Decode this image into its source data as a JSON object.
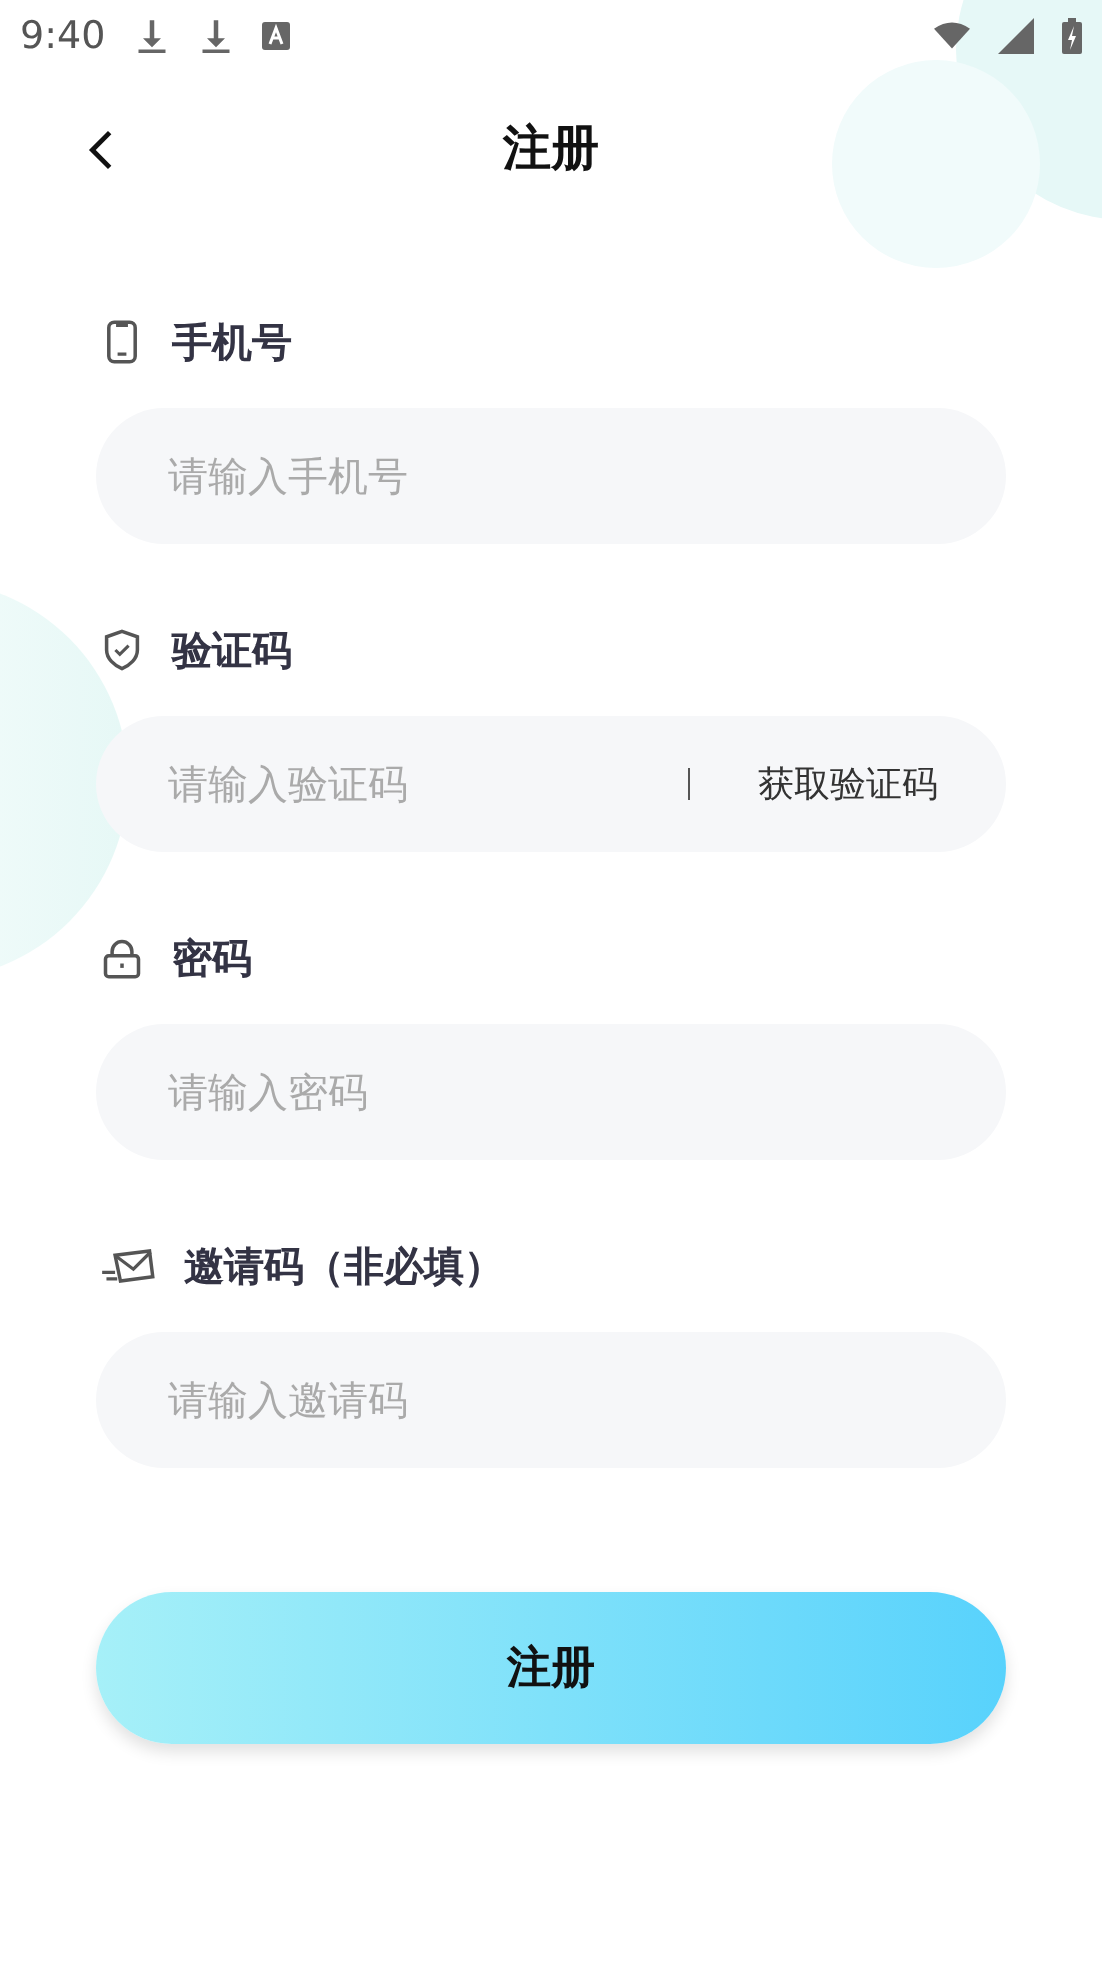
{
  "status_bar": {
    "time": "9:40"
  },
  "header": {
    "title": "注册"
  },
  "fields": [
    {
      "kind": "phone",
      "label": "手机号",
      "placeholder": "请输入手机号"
    },
    {
      "kind": "code",
      "label": "验证码",
      "placeholder": "请输入验证码",
      "action": "获取验证码"
    },
    {
      "kind": "password",
      "label": "密码",
      "placeholder": "请输入密码"
    },
    {
      "kind": "invite",
      "label": "邀请码（非必填）",
      "placeholder": "请输入邀请码"
    }
  ],
  "submit": "注册"
}
